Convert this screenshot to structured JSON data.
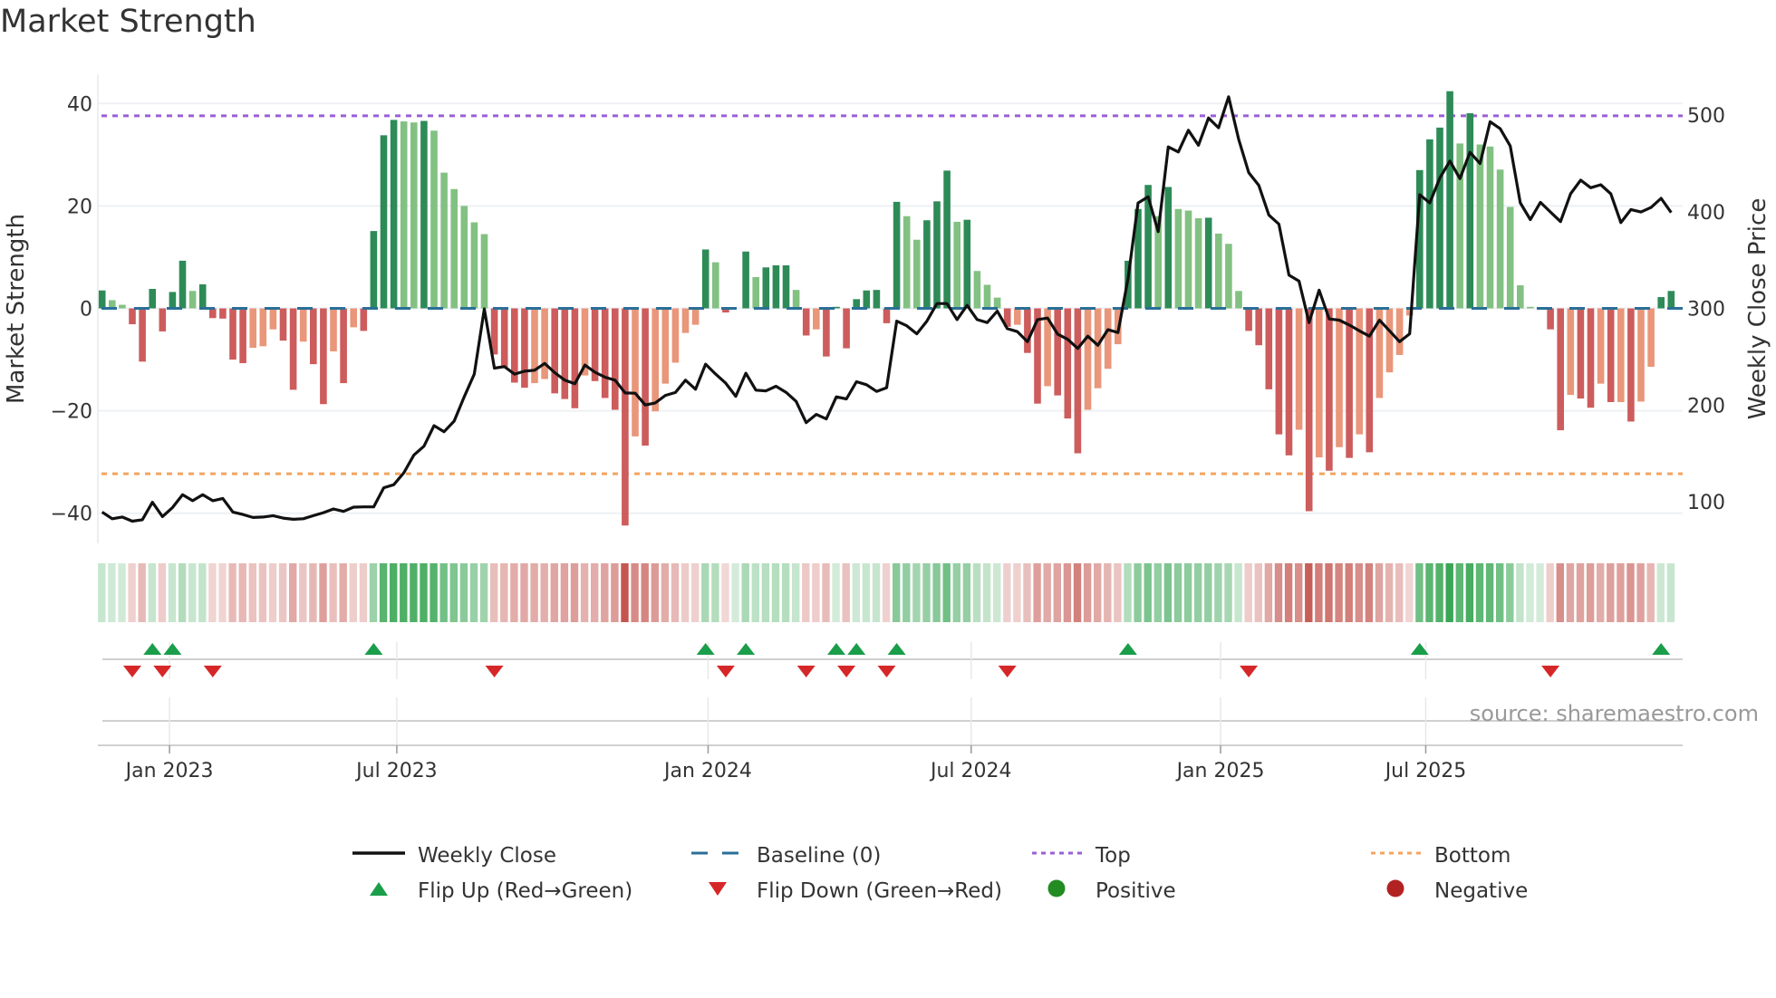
{
  "chart_data": {
    "type": "bar",
    "title": "Market Strength",
    "ylabel": "Market Strength",
    "y2label": "Weekly Close Price",
    "ylim": [
      -46,
      46
    ],
    "y2lim": [
      55,
      560
    ],
    "yticks": [
      -40,
      -20,
      0,
      20,
      40
    ],
    "y2ticks": [
      100,
      200,
      300,
      400,
      500
    ],
    "yticks_labels": [
      "−40",
      "−20",
      "0",
      "20",
      "40"
    ],
    "y2ticks_labels": [
      "100",
      "200",
      "300",
      "400",
      "500"
    ],
    "top_threshold": 37.6,
    "bottom_threshold": -32.3,
    "grid": true,
    "x_ticks": [
      {
        "label": "Jan 2023",
        "week_index": 6.7
      },
      {
        "label": "Jul 2023",
        "week_index": 29.3
      },
      {
        "label": "Jan 2024",
        "week_index": 60.25
      },
      {
        "label": "Jul 2024",
        "week_index": 86.4
      },
      {
        "label": "Jan 2025",
        "week_index": 111.2
      },
      {
        "label": "Jul 2025",
        "week_index": 131.6
      }
    ],
    "strength": [
      3.5,
      1.6,
      0.7,
      -3.1,
      -10.4,
      3.8,
      -4.5,
      3.2,
      9.3,
      3.4,
      4.7,
      -1.9,
      -2.0,
      -10.0,
      -10.7,
      -7.7,
      -7.4,
      -4.1,
      -6.3,
      -15.9,
      -6.5,
      -10.9,
      -18.7,
      -8.4,
      -14.6,
      -3.7,
      -4.4,
      15.1,
      33.8,
      36.8,
      36.5,
      36.3,
      36.6,
      34.7,
      26.5,
      23.3,
      20.0,
      16.8,
      14.5,
      -9,
      -11.4,
      -14.5,
      -15.5,
      -14.6,
      -13.8,
      -16.6,
      -17.7,
      -19.5,
      -13.1,
      -14.2,
      -17.5,
      -19.8,
      -42.4,
      -25,
      -26.8,
      -20.1,
      -14.7,
      -10.6,
      -4.8,
      -3.2,
      11.5,
      9,
      -0.8,
      0,
      11.1,
      6.1,
      8,
      8.4,
      8.4,
      3.6,
      -5.3,
      -4.1,
      -9.4,
      0.3,
      -7.8,
      1.8,
      3.5,
      3.6,
      -2.9,
      20.8,
      18,
      13.4,
      17.2,
      20.9,
      26.9,
      16.9,
      17.3,
      7.3,
      4.6,
      2.1,
      -3.6,
      -3.2,
      -8.7,
      -18.6,
      -15.2,
      -17,
      -21.5,
      -28.3,
      -19.8,
      -15.6,
      -11.8,
      -7,
      9.3,
      19.4,
      24.1,
      18,
      23.7,
      19.4,
      19.1,
      17.6,
      17.7,
      14.6,
      12.6,
      3.4,
      -4.4,
      -7.2,
      -15.8,
      -24.6,
      -28.7,
      -23.7,
      -39.6,
      -29.1,
      -31.7,
      -27.1,
      -29.2,
      -24.6,
      -28.1,
      -17.5,
      -12.5,
      -9.1,
      -1.4,
      27,
      33,
      35.3,
      42.4,
      32.2,
      38.1,
      32,
      31.6,
      27.1,
      19.8,
      4.5,
      0.3,
      0,
      -4.1,
      -23.8,
      -16.9,
      -17.6,
      -19.4,
      -14.7,
      -18.3,
      -18.3,
      -22.1,
      -18.2,
      -11.4,
      2.2,
      3.4
    ],
    "weekly_close": [
      89.3,
      82.4,
      84.2,
      79.9,
      81.4,
      99.4,
      84.6,
      94,
      107.2,
      101,
      107.2,
      101,
      103.4,
      89.3,
      86.8,
      83.7,
      84.2,
      85.6,
      83,
      81.8,
      82.4,
      85.6,
      88.7,
      92.5,
      90,
      94.4,
      94.7,
      94.7,
      114.4,
      117.6,
      130,
      148.3,
      157.4,
      178.7,
      172.4,
      183.4,
      208.5,
      232,
      299.4,
      238.2,
      239.8,
      232,
      235,
      236,
      243,
      233.5,
      225.7,
      222,
      241.4,
      234,
      228.8,
      225.7,
      212.5,
      212.2,
      200,
      202.2,
      210,
      213,
      225.7,
      216.3,
      242.3,
      232,
      222.6,
      209,
      232.9,
      215.4,
      214.7,
      219.4,
      213.2,
      203.8,
      181.8,
      190.3,
      185.6,
      208.5,
      206.3,
      224.1,
      221,
      214.1,
      217.9,
      286.8,
      282,
      273.7,
      286.8,
      305,
      305,
      288.4,
      303.1,
      288.4,
      285.3,
      297.2,
      279,
      275.9,
      265.5,
      288.4,
      290,
      273.4,
      268,
      258.6,
      271.2,
      261.8,
      278,
      275,
      330.7,
      409,
      415.4,
      379.3,
      467,
      461.8,
      484.3,
      468.7,
      496.9,
      486.8,
      518.8,
      474.9,
      440.4,
      427.3,
      396.6,
      387.1,
      334.5,
      328.2,
      285.3,
      318.8,
      289,
      287.8,
      282.8,
      276.8,
      271.2,
      287.8,
      276.8,
      265.5,
      273.7,
      417.6,
      409.1,
      434.8,
      452.4,
      434.2,
      461.4,
      449.8,
      493.1,
      485.9,
      468,
      409.1,
      391.8,
      409.7,
      399.7,
      389.7,
      418.5,
      432.6,
      424.8,
      427.9,
      418.5,
      388.7,
      402.2,
      399.7,
      404.4,
      413.8,
      399.1
    ],
    "flip_up_weeks": [
      5,
      7,
      27,
      60,
      64,
      73,
      75,
      79,
      102,
      131,
      155
    ],
    "flip_down_weeks": [
      3,
      6,
      11,
      39,
      62,
      70,
      74,
      78,
      90,
      114,
      144
    ],
    "legend": [
      {
        "label": "Weekly Close",
        "kind": "line"
      },
      {
        "label": "Baseline (0)",
        "kind": "dash"
      },
      {
        "label": "Top",
        "kind": "dot-purple"
      },
      {
        "label": "Bottom",
        "kind": "dot-orange"
      },
      {
        "label": "Flip Up (Red→Green)",
        "kind": "tri-up"
      },
      {
        "label": "Flip Down (Green→Red)",
        "kind": "tri-down"
      },
      {
        "label": "Positive",
        "kind": "dot-green"
      },
      {
        "label": "Negative",
        "kind": "dot-red"
      }
    ],
    "legend_position": "bottom",
    "source": "source: sharemaestro.com",
    "colors": {
      "pos_rising": "#2e8b57",
      "pos_falling": "#82c182",
      "neg_falling": "#cd5c5c",
      "neg_rising": "#e9967a",
      "line": "#111111",
      "baseline": "#2a6f97",
      "top": "#9b5fd6",
      "bottom": "#f4a460",
      "flip_up": "#1a9e4a",
      "flip_down": "#d62728",
      "positive": "#228b22",
      "negative": "#b22222"
    }
  }
}
